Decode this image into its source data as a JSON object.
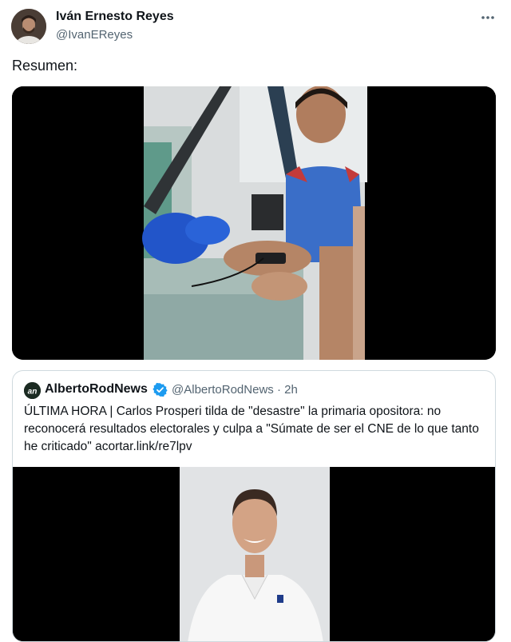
{
  "author": {
    "name": "Iván Ernesto Reyes",
    "handle": "@IvanEReyes"
  },
  "tweet": {
    "text": "Resumen:"
  },
  "icons": {
    "more": "more-horizontal-icon",
    "verified": "verified-badge-icon"
  },
  "quoted_tweet": {
    "author_name": "AlbertoRodNews",
    "author_handle": "@AlbertoRodNews",
    "separator": "·",
    "time": "2h",
    "text": "ÚLTIMA HORA | Carlos Prosperi tilda de \"desastre\" la primaria opositora: no reconocerá resultados electorales y culpa a \"Súmate de ser el CNE de lo que tanto he criticado\" acortar.link/re7lpv"
  },
  "colors": {
    "text_primary": "#0f1419",
    "text_secondary": "#536471",
    "border": "#cfd9de",
    "verified_blue": "#1d9bf0",
    "media_background": "#000000"
  }
}
